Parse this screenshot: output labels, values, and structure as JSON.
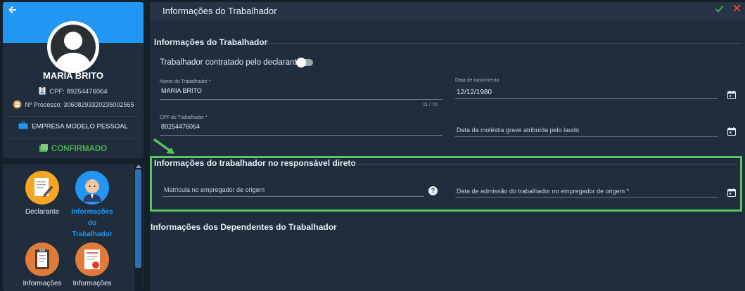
{
  "profile": {
    "name": "MARIA BRITO",
    "cpf_label": "CPF:",
    "cpf_value": "89254476064",
    "process_label": "Nº Processo:",
    "process_value": "30608293320235002565",
    "company": "EMPRESA MODELO PESSOAL",
    "status": "CONFIRMADO"
  },
  "nav": {
    "items": [
      {
        "label": "Declarante",
        "icon": "document-pen-icon",
        "active": false
      },
      {
        "label_lines": [
          "Informações",
          "do",
          "Trabalhador"
        ],
        "icon": "worker-avatar-icon",
        "active": true
      },
      {
        "label": "Informações",
        "icon": "clipboard-icon",
        "active": false
      },
      {
        "label": "Informações",
        "icon": "certificate-icon",
        "active": false
      }
    ]
  },
  "topbar": {
    "title": "Informações do Trabalhador",
    "ok_icon": "check-icon",
    "close_icon": "close-icon"
  },
  "sections": {
    "worker_info": "Informações do Trabalhador",
    "responsible": "Informações do trabalhador no responsável direto",
    "dependents": "Informações dos Dependentes do Trabalhador"
  },
  "form": {
    "toggle_label": "Trabalhador contratado pelo declarante",
    "toggle_on": false,
    "nome_label": "Nome do Trabalhador *",
    "nome_value": "MARIA BRITO",
    "nome_counter": "11 / 70",
    "nascimento_label": "Data de nascimento",
    "nascimento_value": "12/12/1980",
    "cpf_label": "CPF do Trabalhador *",
    "cpf_value": "89254476064",
    "molestia_placeholder": "Data da moléstia grave atribuída pelo laudo",
    "matricula_placeholder": "Matrícula no empregador de origem",
    "admissao_placeholder": "Data de admissão do trabalhador no empregador de origem *"
  },
  "colors": {
    "accent": "#2196f3",
    "highlight": "#59c460",
    "confirm": "#4caf50",
    "close": "#f44336"
  }
}
